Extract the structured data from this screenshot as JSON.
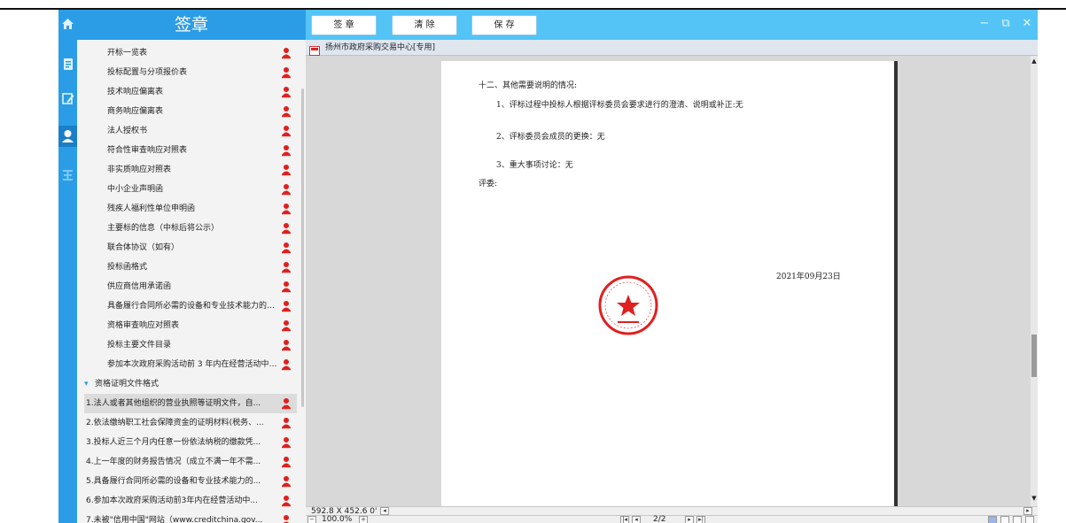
{
  "app": {
    "title": "签章",
    "toolbar": {
      "sign_label": "签 章",
      "clear_label": "清 除",
      "save_label": "保 存"
    },
    "window_controls": {
      "minimize": "−",
      "restore": "⧉",
      "close": "✕"
    }
  },
  "sidebar": {
    "items": [
      {
        "label": "开标一览表"
      },
      {
        "label": "投标配置与分项报价表"
      },
      {
        "label": "技术响应偏离表"
      },
      {
        "label": "商务响应偏离表"
      },
      {
        "label": "法人授权书"
      },
      {
        "label": "符合性审查响应对照表"
      },
      {
        "label": "非实质响应对照表"
      },
      {
        "label": "中小企业声明函"
      },
      {
        "label": "残疾人福利性单位申明函"
      },
      {
        "label": "主要标的信息（中标后将公示）"
      },
      {
        "label": "联合体协议（如有）"
      },
      {
        "label": "投标函格式"
      },
      {
        "label": "供应商信用承诺函"
      },
      {
        "label": "具备履行合同所必需的设备和专业技术能力的书..."
      },
      {
        "label": "资格审查响应对照表"
      },
      {
        "label": "投标主要文件目录"
      },
      {
        "label": "参加本次政府采购活动前 3 年内在经营活动中没..."
      }
    ],
    "group": {
      "label": "资格证明文件格式"
    },
    "sub_items": [
      {
        "label": "1.法人或者其他组织的营业执照等证明文件，自..."
      },
      {
        "label": "2.依法缴纳职工社会保障资金的证明材料(税务、..."
      },
      {
        "label": "3.投标人近三个月内任意一份依法纳税的缴款凭..."
      },
      {
        "label": "4.上一年度的财务报告情况（成立不满一年不需..."
      },
      {
        "label": "5.具备履行合同所必需的设备和专业技术能力的..."
      },
      {
        "label": "6.参加本次政府采购活动前3年内在经营活动中..."
      },
      {
        "label": "7.未被\"信用中国\"网站（www.creditchina.gov..."
      }
    ]
  },
  "document": {
    "tab_title": "扬州市政府采购交易中心[专用]",
    "lines": {
      "heading": "十二、其他需要说明的情况:",
      "line1": "1、评标过程中投标人根据评标委员会要求进行的澄清、说明或补正:无",
      "line2": "2、评标委员会成员的更换：无",
      "line3": "3、重大事项讨论：无",
      "reviewer": "评委:",
      "date": "2021年09月23日"
    },
    "seal_color": "#e02020"
  },
  "status": {
    "page_size": "592.8 X 452.6 0'",
    "zoom": "100.0%",
    "page_indicator": "2/2"
  },
  "colors": {
    "accent": "#2b9de6",
    "header": "#53c4f5",
    "person_icon": "#e0201e"
  }
}
